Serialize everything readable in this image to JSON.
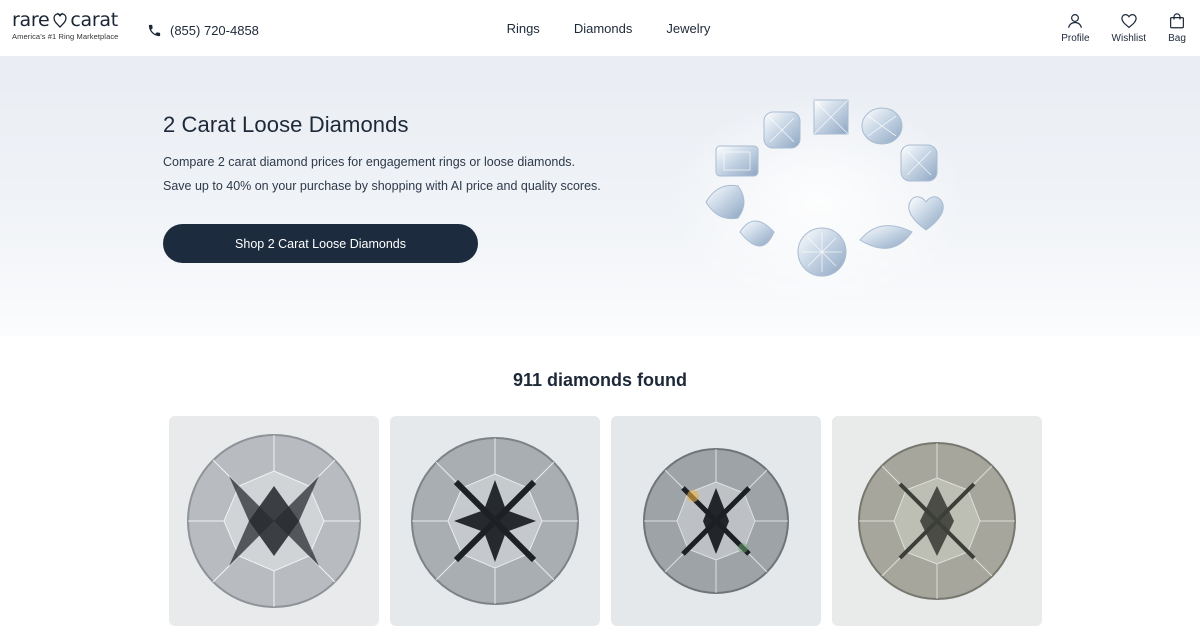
{
  "header": {
    "logo": {
      "wordmark_left": "rare",
      "wordmark_right": "carat",
      "tagline": "America's #1 Ring Marketplace"
    },
    "phone": "(855) 720-4858",
    "nav": [
      {
        "label": "Rings"
      },
      {
        "label": "Diamonds"
      },
      {
        "label": "Jewelry"
      }
    ],
    "actions": [
      {
        "label": "Profile",
        "icon": "user-icon"
      },
      {
        "label": "Wishlist",
        "icon": "heart-icon"
      },
      {
        "label": "Bag",
        "icon": "bag-icon"
      }
    ]
  },
  "hero": {
    "title": "2 Carat Loose Diamonds",
    "line1": "Compare 2 carat diamond prices for engagement rings or loose diamonds.",
    "line2": "Save up to 40% on your purchase by shopping with AI price and quality scores.",
    "cta": "Shop 2 Carat Loose Diamonds"
  },
  "results": {
    "count_text": "911 diamonds found",
    "cards": [
      {
        "image": "round-diamond-photo",
        "bg": "#e8eaec"
      },
      {
        "image": "round-diamond-photo",
        "bg": "#e6e9eb"
      },
      {
        "image": "round-diamond-photo",
        "bg": "#e5e8ea"
      },
      {
        "image": "round-diamond-photo",
        "bg": "#e9eaea"
      }
    ]
  },
  "colors": {
    "navy": "#1d2b3f",
    "text": "#1d2939",
    "hero_bg": "#eef1f5"
  }
}
